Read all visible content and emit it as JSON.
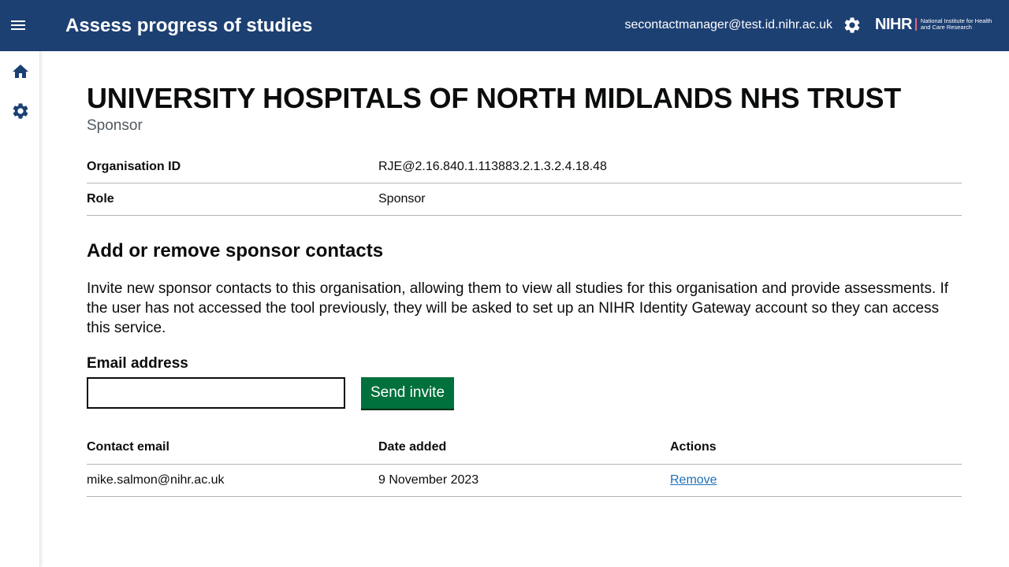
{
  "header": {
    "app_title": "Assess progress of studies",
    "user_email": "secontactmanager@test.id.nihr.ac.uk",
    "logo_text": "NIHR",
    "logo_subtext": "National Institute for Health and Care Research",
    "background_color": "#1d4073"
  },
  "sidebar": {
    "items": [
      {
        "icon": "home-icon"
      },
      {
        "icon": "gear-icon"
      }
    ]
  },
  "organisation": {
    "name": "UNIVERSITY HOSPITALS OF NORTH MIDLANDS NHS TRUST",
    "caption": "Sponsor",
    "summary": [
      {
        "key": "Organisation ID",
        "value": "RJE@2.16.840.1.113883.2.1.3.2.4.18.48"
      },
      {
        "key": "Role",
        "value": "Sponsor"
      }
    ]
  },
  "contacts_section": {
    "heading": "Add or remove sponsor contacts",
    "body": "Invite new sponsor contacts to this organisation, allowing them to view all studies for this organisation and provide assessments. If the user has not accessed the tool previously, they will be asked to set up an NIHR Identity Gateway account so they can access this service.",
    "email_label": "Email address",
    "email_value": "",
    "send_label": "Send invite",
    "button_color": "#00703c"
  },
  "contacts_table": {
    "headers": [
      "Contact email",
      "Date added",
      "Actions"
    ],
    "rows": [
      {
        "email": "mike.salmon@nihr.ac.uk",
        "date_added": "9 November 2023",
        "action": "Remove"
      }
    ]
  }
}
